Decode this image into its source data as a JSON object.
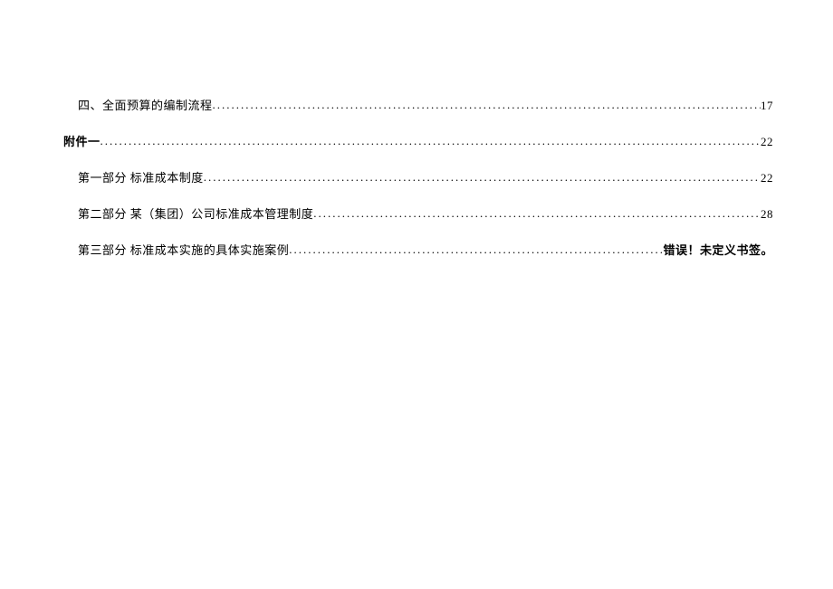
{
  "toc": [
    {
      "level": 2,
      "title": "四、全面预算的编制流程",
      "page": "17",
      "error": false
    },
    {
      "level": 1,
      "title": "附件一",
      "page": "22",
      "error": false
    },
    {
      "level": 2,
      "title": "第一部分  标准成本制度",
      "page": "22",
      "error": false
    },
    {
      "level": 2,
      "title": "第二部分  某（集团）公司标准成本管理制度",
      "page": "28",
      "error": false
    },
    {
      "level": 2,
      "title": "第三部分 标准成本实施的具体实施案例",
      "page": "错误！未定义书签。",
      "error": true
    }
  ]
}
